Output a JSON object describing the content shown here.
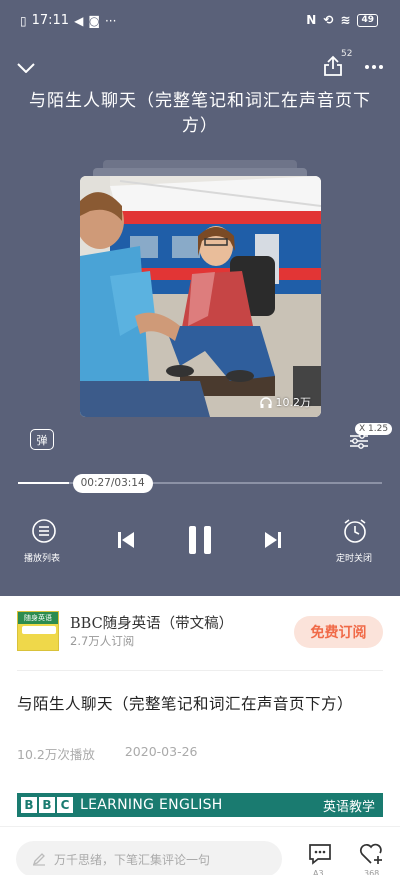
{
  "status_bar": {
    "time": "17:11",
    "battery": "49"
  },
  "player": {
    "share_count": "52",
    "title": "与陌生人聊天（完整笔记和词汇在声音页下方）",
    "cover_plays": "10.2万",
    "danmu_label": "弹",
    "speed": "X 1.25",
    "progress_text": "00:27/03:14",
    "progress_fraction": 0.139,
    "controls": {
      "playlist_label": "播放列表",
      "timer_label": "定时关闭"
    }
  },
  "album": {
    "name": "BBC随身英语（带文稿）",
    "subscribers": "2.7万人订阅",
    "subscribe_label": "免费订阅",
    "cover_text": "随身英语"
  },
  "episode": {
    "title": "与陌生人聊天（完整笔记和词汇在声音页下方）",
    "plays": "10.2万次播放",
    "date": "2020-03-26"
  },
  "banner": {
    "letters": [
      "B",
      "B",
      "C"
    ],
    "word": "LEARNING ENGLISH",
    "tag": "英语教学"
  },
  "bottom_bar": {
    "comment_placeholder": "万千思绪，下笔汇集评论一句",
    "comment_count": "A3",
    "like_count": "368"
  },
  "colors": {
    "player_bg": "#5a6179",
    "accent": "#f06a48",
    "banner_bg": "#1a7b70"
  }
}
